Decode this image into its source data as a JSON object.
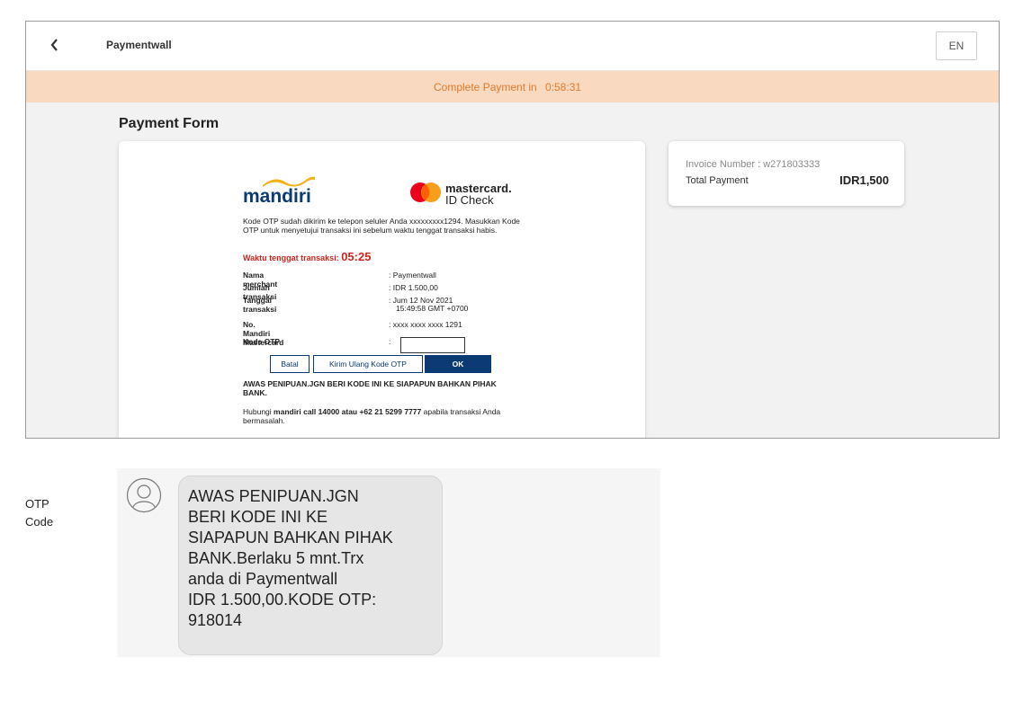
{
  "header": {
    "back_icon": "chevron-left-icon",
    "app_title": "Paymentwall",
    "language": "EN"
  },
  "timer": {
    "label": "Complete Payment in",
    "value": "0:58:31"
  },
  "form": {
    "title": "Payment Form"
  },
  "invoice": {
    "number_text": "Invoice Number : w271803333",
    "total_label": "Total Payment",
    "total_value": "IDR1,500"
  },
  "otp_page": {
    "bank_logo_text": "mandiri",
    "mc_line1": "mastercard.",
    "mc_line2": "ID Check",
    "instructions": "Kode OTP sudah dikirim ke telepon seluler Anda xxxxxxxxx1294. Masukkan Kode OTP untuk menyetujui transaksi ini sebelum waktu tenggat transaksi habis.",
    "deadline_label": "Waktu tenggat transaksi:",
    "deadline_time": "05:25",
    "rows": [
      {
        "label": "Nama merchant",
        "value": ": Paymentwall"
      },
      {
        "label": "Jumlah transaksi",
        "value": ": IDR 1.500,00"
      },
      {
        "label": "Tanggal transaksi",
        "value": ": Jum 12 Nov 2021"
      },
      {
        "label": "",
        "value": "15:49:58 GMT +0700"
      },
      {
        "label": "No. Mandiri Mastercard",
        "value": ": xxxx xxxx xxxx 1291"
      },
      {
        "label": "Kode OTP",
        "value": ":"
      }
    ],
    "otp_input_value": "",
    "btn_cancel": "Batal",
    "btn_resend": "Kirim Ulang Kode OTP",
    "btn_ok": "OK",
    "warning": "AWAS PENIPUAN.JGN BERI KODE INI KE SIAPAPUN BAHKAN PIHAK BANK.",
    "contact_pre": "Hubungi ",
    "contact_bold1": "mandiri call 14000 atau +62 21 5299 7777",
    "contact_post": " apabila transaksi Anda bermasalah."
  },
  "sms": {
    "side_label_line1": "OTP",
    "side_label_line2": "Code",
    "avatar_icon": "user-avatar-icon",
    "message": "AWAS PENIPUAN.JGN\nBERI KODE INI KE\nSIAPAPUN BAHKAN PIHAK\nBANK.Berlaku 5 mnt.Trx\nanda di Paymentwall\nIDR 1.500,00.KODE OTP:\n918014"
  },
  "colors": {
    "timer_bg": "#f9d9bf",
    "timer_text": "#e07a2d",
    "mandiri_blue": "#0b3a75",
    "deadline_red": "#d0261c",
    "mandiri_yellow": "#f5b016"
  }
}
